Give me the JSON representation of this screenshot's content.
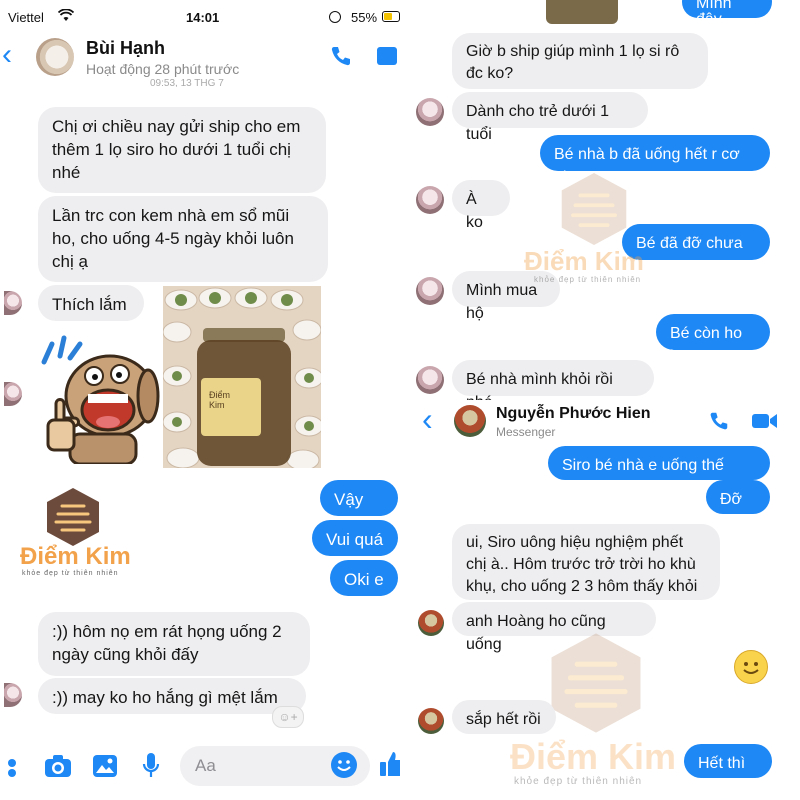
{
  "left": {
    "status_bar": {
      "carrier": "Viettel",
      "time": "14:01",
      "battery": "55%"
    },
    "header": {
      "name": "Bùi Hạnh",
      "status": "Hoạt động 28 phút trước",
      "partial_time": "09:53, 13 THG 7"
    },
    "messages": [
      "Chị ơi chiều nay gửi ship cho em thêm 1 lọ siro ho dưới 1 tuổi chị nhé",
      "Lần trc con kem nhà em sổ mũi ho, cho uống 4-5 ngày khỏi luôn chị ạ",
      "Thích lắm",
      "Vậy ah",
      "Vui quá",
      "Oki e",
      ":)) hôm nọ em rát họng uống 2 ngày cũng khỏi đấy",
      ":)) may ko ho hắng gì mệt lắm"
    ],
    "composer": {
      "placeholder": "Aa"
    },
    "watermark": {
      "brand": "Điểm Kim",
      "tagline": "khỏe đẹp từ thiên nhiên"
    }
  },
  "right": {
    "messages_top": [
      "Giờ b ship giúp mình 1 lọ si rô đc ko?",
      "Dành cho trẻ dưới 1 tuổi",
      "Bé nhà b đã uống hết r cơ ah",
      "À ko",
      "Bé đã đỡ chưa b?",
      "Mình mua hộ",
      "Bé còn ho k?",
      "Bé nhà mình  khỏi rồi nhé"
    ],
    "header2": {
      "name": "Nguyễn Phước Hien",
      "subtitle": "Messenger"
    },
    "messages_bottom": [
      "Siro bé nhà e uống thế nào?",
      "Đỡ k?",
      "ui, Siro uông hiệu nghiệm phết chị à.. Hôm trước trở trời ho khù khụ, cho uống 2 3 hôm thấy khỏi",
      "anh Hoàng ho cũng uống",
      "sắp hết rồi",
      "Hết thì ới"
    ],
    "top_partial": "Mình đây",
    "watermark": {
      "brand": "Điểm Kim",
      "tagline": "khỏe đẹp từ thiên nhiên"
    }
  },
  "colors": {
    "accent": "#1e88f5",
    "incoming": "#eeeef0",
    "brand": "#f2a24a"
  }
}
